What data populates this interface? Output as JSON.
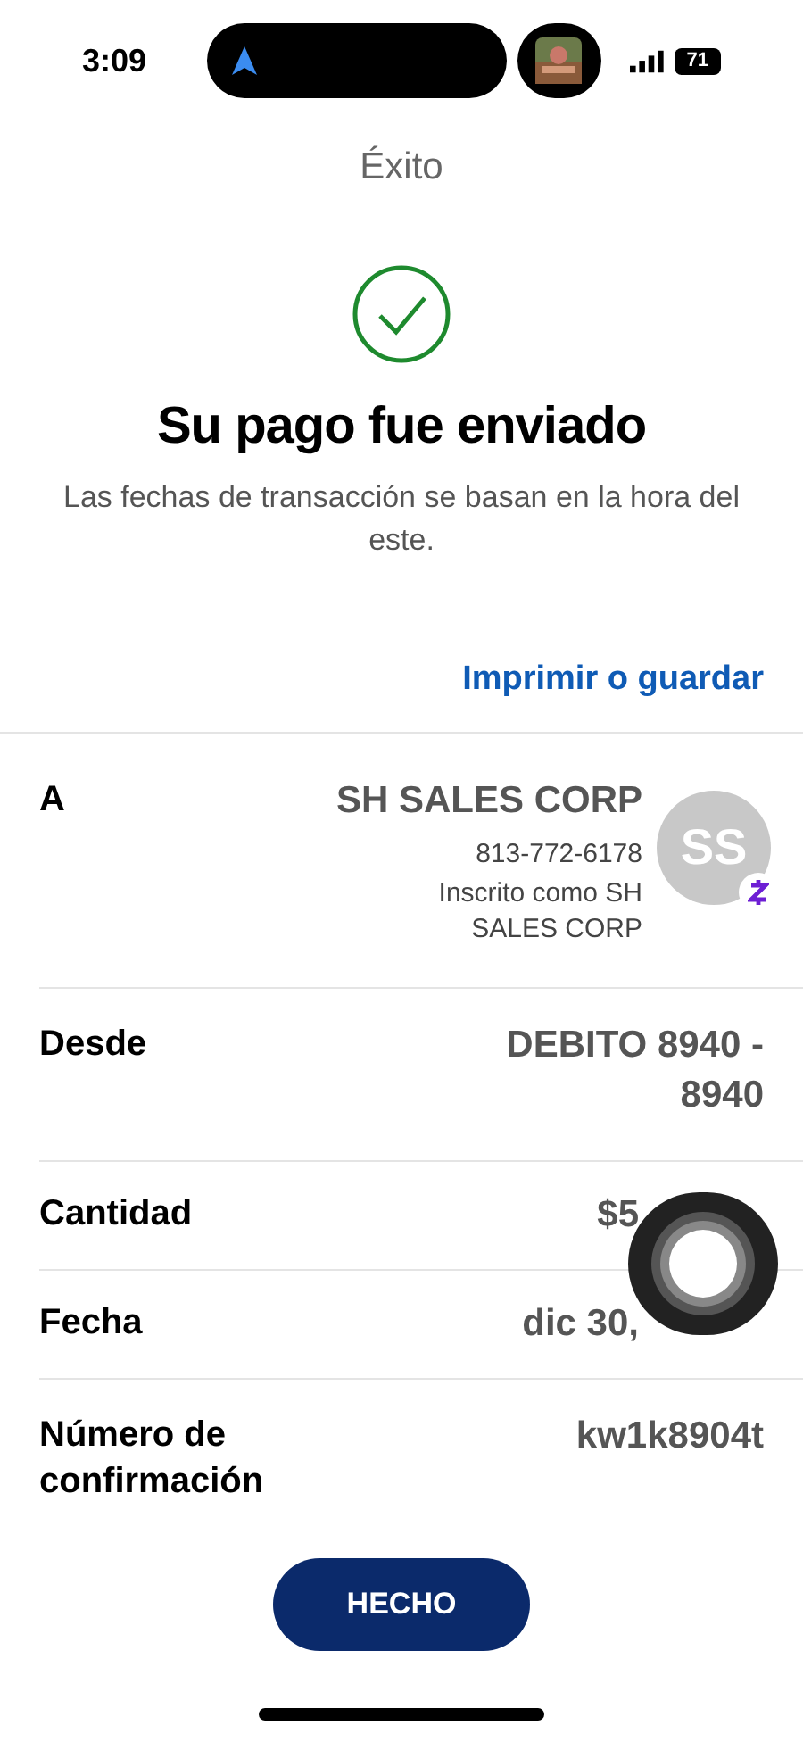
{
  "status_bar": {
    "time": "3:09",
    "battery": "71"
  },
  "header": {
    "title": "Éxito"
  },
  "success": {
    "heading": "Su pago fue enviado",
    "note": "Las fechas de transacción se basan en la hora del este."
  },
  "print_link": "Imprimir o guardar",
  "recipient": {
    "label": "A",
    "name": "SH SALES CORP",
    "phone": "813-772-6178",
    "enrolled": "Inscrito como SH SALES CORP",
    "initials": "SS"
  },
  "details": [
    {
      "label": "Desde",
      "value": "DEBITO 8940 - 8940"
    },
    {
      "label": "Cantidad",
      "value": "$5"
    },
    {
      "label": "Fecha",
      "value": "dic 30,"
    },
    {
      "label": "Número de confirmación",
      "value": "kw1k8904t"
    }
  ],
  "done_button": "HECHO"
}
